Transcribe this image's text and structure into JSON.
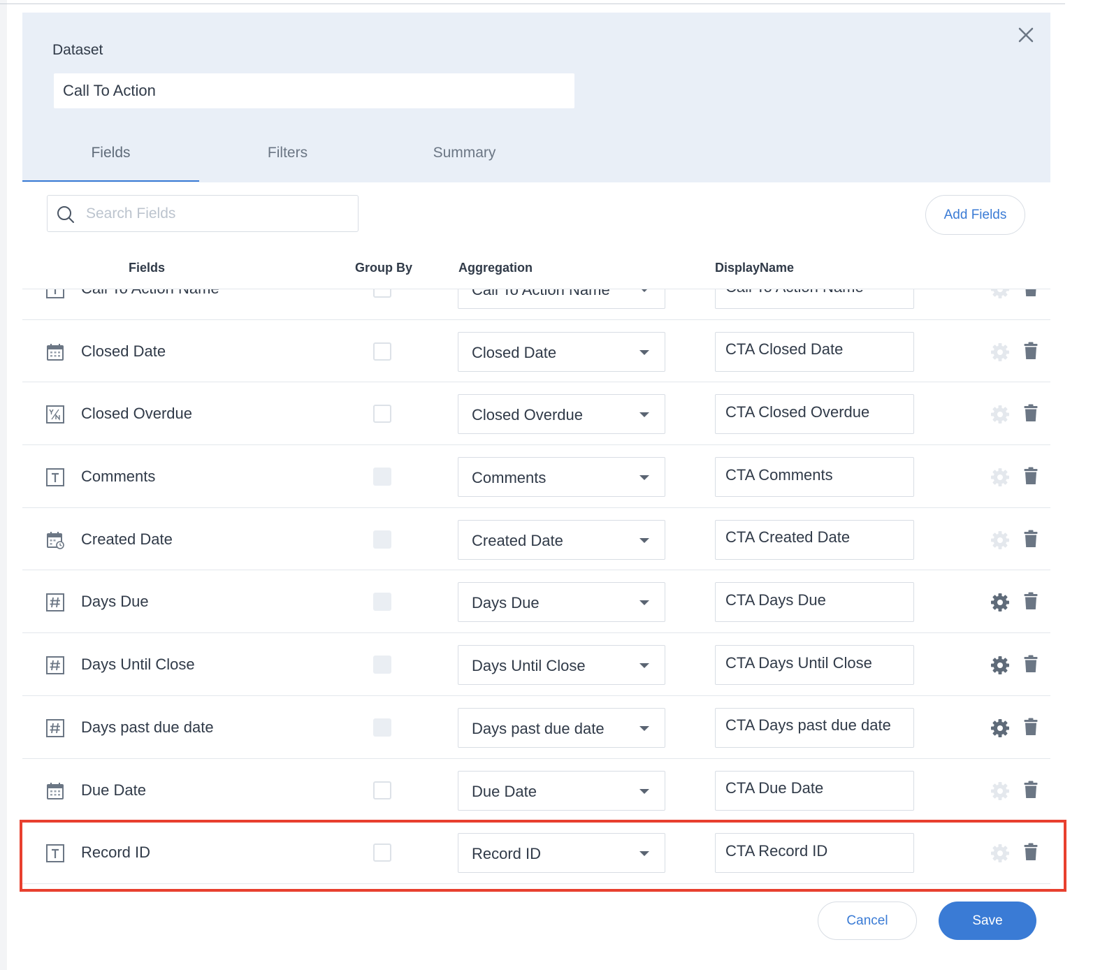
{
  "dataset": {
    "label": "Dataset",
    "value": "Call To Action"
  },
  "tabs": [
    {
      "label": "Fields",
      "active": true
    },
    {
      "label": "Filters",
      "active": false
    },
    {
      "label": "Summary",
      "active": false
    }
  ],
  "search": {
    "placeholder": "Search Fields",
    "value": ""
  },
  "add_fields_label": "Add Fields",
  "columns": {
    "fields": "Fields",
    "group_by": "Group By",
    "aggregation": "Aggregation",
    "display_name": "DisplayName"
  },
  "rows": [
    {
      "field": "Call To Action Name",
      "icon": "text-field-icon",
      "group_by": "unchecked",
      "aggregation": "Call To Action Name",
      "display_name": "Call To Action Name",
      "settings_enabled": false
    },
    {
      "field": "Closed Date",
      "icon": "calendar-icon",
      "group_by": "unchecked",
      "aggregation": "Closed Date",
      "display_name": "CTA Closed Date",
      "settings_enabled": false
    },
    {
      "field": "Closed Overdue",
      "icon": "boolean-field-icon",
      "group_by": "unchecked",
      "aggregation": "Closed Overdue",
      "display_name": "CTA Closed Overdue",
      "settings_enabled": false
    },
    {
      "field": "Comments",
      "icon": "text-field-icon",
      "group_by": "disabled",
      "aggregation": "Comments",
      "display_name": "CTA Comments",
      "settings_enabled": false
    },
    {
      "field": "Created Date",
      "icon": "datetime-icon",
      "group_by": "disabled",
      "aggregation": "Created Date",
      "display_name": "CTA Created Date",
      "settings_enabled": false
    },
    {
      "field": "Days Due",
      "icon": "number-field-icon",
      "group_by": "disabled",
      "aggregation": "Days Due",
      "display_name": "CTA Days Due",
      "settings_enabled": true
    },
    {
      "field": "Days Until Close",
      "icon": "number-field-icon",
      "group_by": "disabled",
      "aggregation": "Days Until Close",
      "display_name": "CTA Days Until Close",
      "settings_enabled": true
    },
    {
      "field": "Days past due date",
      "icon": "number-field-icon",
      "group_by": "disabled",
      "aggregation": "Days past due date",
      "display_name": "CTA Days past due date",
      "settings_enabled": true
    },
    {
      "field": "Due Date",
      "icon": "calendar-icon",
      "group_by": "unchecked",
      "aggregation": "Due Date",
      "display_name": "CTA Due Date",
      "settings_enabled": false
    },
    {
      "field": "Record ID",
      "icon": "text-field-icon",
      "group_by": "unchecked",
      "aggregation": "Record ID",
      "display_name": "CTA Record ID",
      "settings_enabled": false
    }
  ],
  "footer": {
    "cancel_label": "Cancel",
    "save_label": "Save"
  },
  "colors": {
    "accent": "#3a7bd5",
    "highlight": "#e8402f",
    "header_bg": "#e9eff7"
  }
}
